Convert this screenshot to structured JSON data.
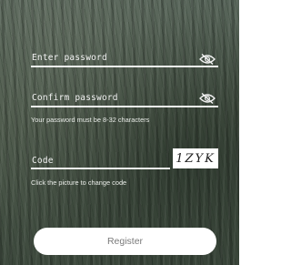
{
  "form": {
    "password": {
      "placeholder": "Enter password",
      "toggle_icon": "eye-hidden-icon"
    },
    "confirm_password": {
      "placeholder": "Confirm password",
      "toggle_icon": "eye-hidden-icon"
    },
    "password_hint": "Your password must be 8-32 characters",
    "code": {
      "placeholder": "Code",
      "captcha_text": "1ZYK"
    },
    "code_hint": "Click the picture to change code",
    "register_label": "Register"
  }
}
